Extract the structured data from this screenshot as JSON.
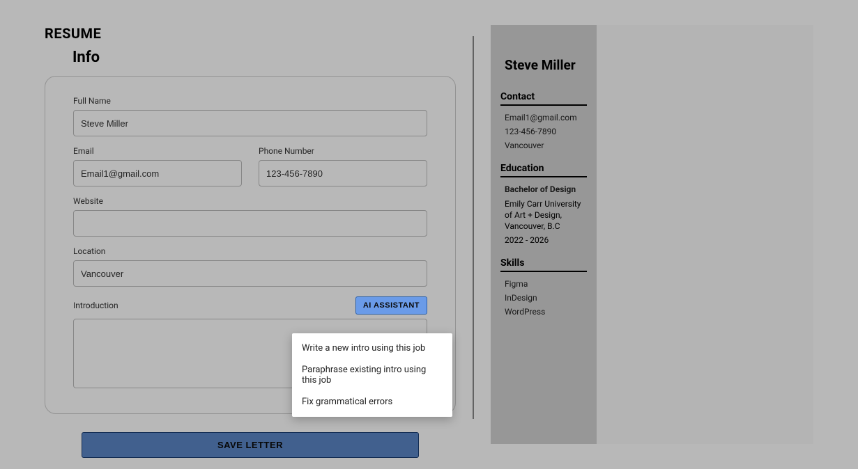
{
  "header": {
    "page_title": "RESUME",
    "section_title": "Info"
  },
  "form": {
    "full_name_label": "Full Name",
    "full_name_value": "Steve Miller",
    "email_label": "Email",
    "email_value": "Email1@gmail.com",
    "phone_label": "Phone Number",
    "phone_value": "123-456-7890",
    "website_label": "Website",
    "website_value": "",
    "location_label": "Location",
    "location_value": "Vancouver",
    "intro_label": "Introduction",
    "intro_value": "",
    "ai_button_label": "AI ASSISTANT",
    "save_button_label": "SAVE LETTER"
  },
  "ai_menu": {
    "items": [
      "Write a new intro using this job",
      "Paraphrase existing intro using this job",
      "Fix grammatical errors"
    ]
  },
  "preview": {
    "name": "Steve Miller",
    "contact": {
      "heading": "Contact",
      "email": "Email1@gmail.com",
      "phone": "123-456-7890",
      "location": "Vancouver"
    },
    "education": {
      "heading": "Education",
      "degree": "Bachelor of Design",
      "school": "Emily Carr University of Art + Design, Vancouver, B.C",
      "years": "2022 - 2026"
    },
    "skills": {
      "heading": "Skills",
      "items": [
        "Figma",
        "InDesign",
        "WordPress"
      ]
    }
  }
}
